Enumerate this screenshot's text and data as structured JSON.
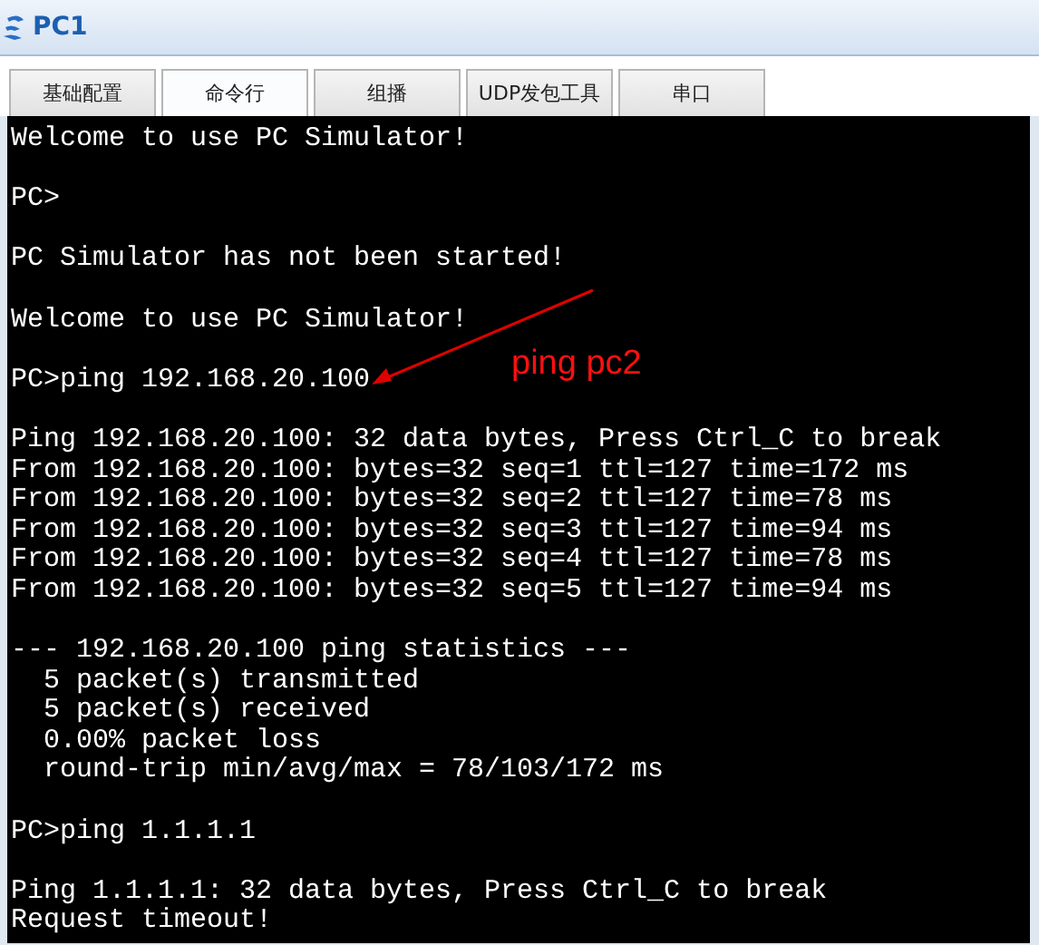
{
  "window": {
    "title": "PC1"
  },
  "tabs": [
    {
      "label": "基础配置",
      "selected": false
    },
    {
      "label": "命令行",
      "selected": true
    },
    {
      "label": "组播",
      "selected": false
    },
    {
      "label": "UDP发包工具",
      "selected": false
    },
    {
      "label": "串口",
      "selected": false
    }
  ],
  "terminal": {
    "blocks": [
      [
        "Welcome to use PC Simulator!"
      ],
      [
        "PC>"
      ],
      [
        "PC Simulator has not been started!"
      ],
      [
        "Welcome to use PC Simulator!"
      ],
      [
        "PC>ping 192.168.20.100"
      ],
      [
        "Ping 192.168.20.100: 32 data bytes, Press Ctrl_C to break",
        "From 192.168.20.100: bytes=32 seq=1 ttl=127 time=172 ms",
        "From 192.168.20.100: bytes=32 seq=2 ttl=127 time=78 ms",
        "From 192.168.20.100: bytes=32 seq=3 ttl=127 time=94 ms",
        "From 192.168.20.100: bytes=32 seq=4 ttl=127 time=78 ms",
        "From 192.168.20.100: bytes=32 seq=5 ttl=127 time=94 ms"
      ],
      [
        "--- 192.168.20.100 ping statistics ---",
        "  5 packet(s) transmitted",
        "  5 packet(s) received",
        "  0.00% packet loss",
        "  round-trip min/avg/max = 78/103/172 ms"
      ],
      [
        "PC>ping 1.1.1.1"
      ],
      [
        "Ping 1.1.1.1: 32 data bytes, Press Ctrl_C to break",
        "Request timeout!"
      ]
    ],
    "annotation": {
      "text": "ping pc2"
    }
  }
}
